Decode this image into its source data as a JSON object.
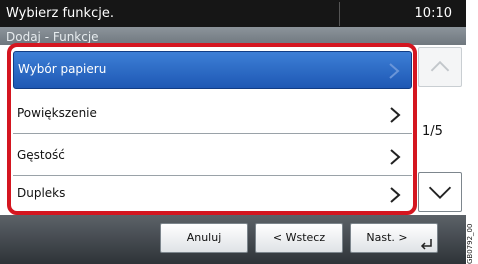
{
  "header": {
    "title": "Wybierz funkcje.",
    "time": "10:10",
    "subtitle": "Dodaj - Funkcje"
  },
  "list": {
    "items": [
      {
        "label": "Wybór papieru",
        "selected": true
      },
      {
        "label": "Powiększenie",
        "selected": false
      },
      {
        "label": "Gęstość",
        "selected": false
      },
      {
        "label": "Dupleks",
        "selected": false
      }
    ],
    "page_indicator": "1/5"
  },
  "footer": {
    "cancel_label": "Anuluj",
    "back_label": "< Wstecz",
    "next_label": "Nast. >"
  },
  "figure_code": "GB0792_00",
  "colors": {
    "highlight_frame": "#d41620",
    "selected_item": "#2a68c4"
  }
}
